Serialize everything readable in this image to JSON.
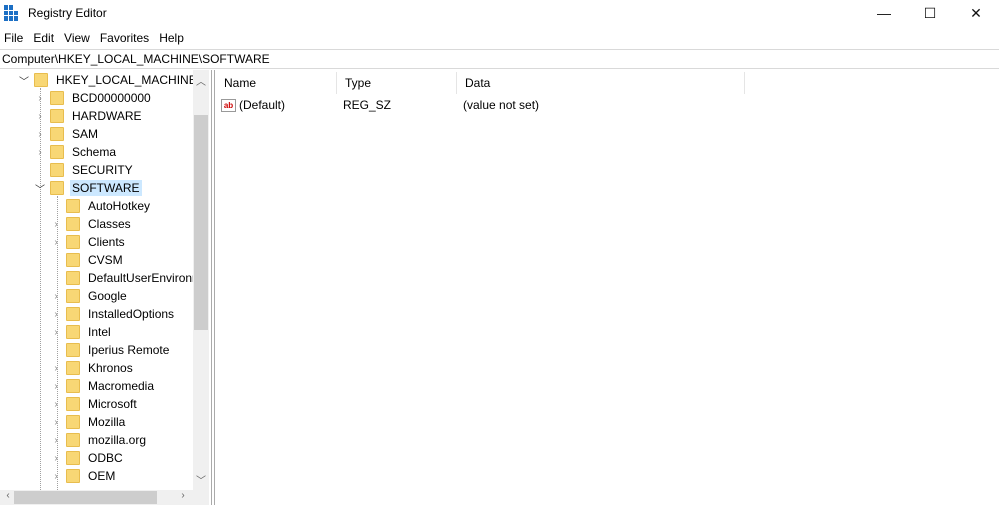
{
  "window": {
    "title": "Registry Editor",
    "minimize": "—",
    "maximize": "☐",
    "close": "✕"
  },
  "menu": [
    "File",
    "Edit",
    "View",
    "Favorites",
    "Help"
  ],
  "address": "Computer\\HKEY_LOCAL_MACHINE\\SOFTWARE",
  "tree": [
    {
      "label": "HKEY_LOCAL_MACHINE",
      "level": 0,
      "expander": "expanded"
    },
    {
      "label": "BCD00000000",
      "level": 1,
      "expander": "collapsed"
    },
    {
      "label": "HARDWARE",
      "level": 1,
      "expander": "collapsed"
    },
    {
      "label": "SAM",
      "level": 1,
      "expander": "collapsed"
    },
    {
      "label": "Schema",
      "level": 1,
      "expander": "collapsed"
    },
    {
      "label": "SECURITY",
      "level": 1,
      "expander": "none"
    },
    {
      "label": "SOFTWARE",
      "level": 1,
      "expander": "expanded",
      "selected": true
    },
    {
      "label": "AutoHotkey",
      "level": 2,
      "expander": "none"
    },
    {
      "label": "Classes",
      "level": 2,
      "expander": "collapsed"
    },
    {
      "label": "Clients",
      "level": 2,
      "expander": "collapsed"
    },
    {
      "label": "CVSM",
      "level": 2,
      "expander": "none"
    },
    {
      "label": "DefaultUserEnvironment",
      "level": 2,
      "expander": "none"
    },
    {
      "label": "Google",
      "level": 2,
      "expander": "collapsed"
    },
    {
      "label": "InstalledOptions",
      "level": 2,
      "expander": "collapsed"
    },
    {
      "label": "Intel",
      "level": 2,
      "expander": "collapsed"
    },
    {
      "label": "Iperius Remote",
      "level": 2,
      "expander": "none"
    },
    {
      "label": "Khronos",
      "level": 2,
      "expander": "collapsed"
    },
    {
      "label": "Macromedia",
      "level": 2,
      "expander": "collapsed"
    },
    {
      "label": "Microsoft",
      "level": 2,
      "expander": "collapsed"
    },
    {
      "label": "Mozilla",
      "level": 2,
      "expander": "collapsed"
    },
    {
      "label": "mozilla.org",
      "level": 2,
      "expander": "collapsed"
    },
    {
      "label": "ODBC",
      "level": 2,
      "expander": "collapsed"
    },
    {
      "label": "OEM",
      "level": 2,
      "expander": "collapsed"
    }
  ],
  "columns": [
    "Name",
    "Type",
    "Data"
  ],
  "values": [
    {
      "name": "(Default)",
      "type": "REG_SZ",
      "data": "(value not set)",
      "icon": "string-value-icon"
    }
  ],
  "colors": {
    "selection": "#cce8ff",
    "folder": "#f8d775",
    "app_icon": "#1c6fc4"
  }
}
